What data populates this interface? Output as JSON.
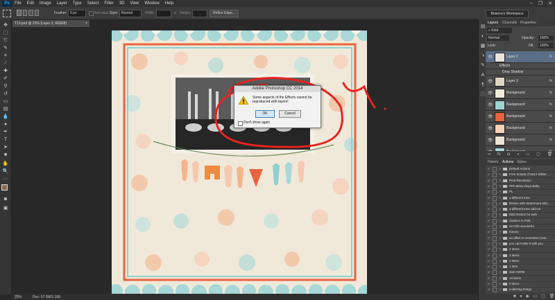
{
  "app": {
    "logo": "Ps"
  },
  "menu": [
    "File",
    "Edit",
    "Image",
    "Layer",
    "Type",
    "Select",
    "Filter",
    "3D",
    "View",
    "Window",
    "Help"
  ],
  "window_controls": [
    "–",
    "❐",
    "✕"
  ],
  "options_bar": {
    "feather_label": "Feather:",
    "feather_value": "0 px",
    "anti_alias_label": "Anti-alias",
    "style_label": "Style:",
    "style_value": "Normal",
    "width_label": "Width:",
    "height_label": "Height:",
    "refine_edge_label": "Refine Edge...",
    "workspace": "Brianna's Workspace"
  },
  "document_tab": "T10.psd @ 25% (Layer 2, RGB/8)",
  "status": {
    "zoom": "25%",
    "doc": "Doc: 37.3M/1.19G"
  },
  "dialog": {
    "title": "Adobe Photoshop CC 2014",
    "message": "Some aspects of the Effects cannot be reproduced with layers!",
    "ok_label": "OK",
    "cancel_label": "Cancel",
    "dont_show_label": "Don't show again"
  },
  "layers_panel": {
    "tabs": [
      "Layers",
      "Channels",
      "Properties"
    ],
    "kind_label": "Kind",
    "blend_mode": "Normal",
    "opacity_label": "Opacity:",
    "opacity_value": "100%",
    "lock_label": "Lock:",
    "fill_label": "Fill:",
    "fill_value": "100%",
    "layers": [
      {
        "name": "Layer 2",
        "fx": "fx",
        "color": "#e9e4d8"
      },
      {
        "name": "Effects",
        "fx": "",
        "color": ""
      },
      {
        "name": "Drop Shadow",
        "fx": "",
        "color": ""
      },
      {
        "name": "Layer 3",
        "fx": "fx",
        "color": "#ddd6c6"
      },
      {
        "name": "Background",
        "fx": "fx",
        "color": "#f0e9d9"
      },
      {
        "name": "Background",
        "fx": "fx",
        "color": "#9fd3d2"
      },
      {
        "name": "Background",
        "fx": "fx",
        "color": "#e8643f"
      },
      {
        "name": "Background",
        "fx": "fx",
        "color": "#f3d2b9"
      },
      {
        "name": "Background",
        "fx": "fx",
        "color": "#ece3d2"
      },
      {
        "name": "Background",
        "fx": "fx",
        "color": "#a8d8d8"
      }
    ]
  },
  "actions_panel": {
    "tabs": [
      "History",
      "Actions",
      "Styles"
    ],
    "actions": [
      "Default Actions",
      "Free Scripts (©2013 Glitter ...",
      "Print Resolution",
      "PPA Many Days Baby",
      "PL",
      "a different tone",
      "Resize with Watermark 600...",
      "a different tone add-on",
      "EBS Resize for web",
      "classics in PSE",
      "isn't life wonderful",
      "harvey",
      "an affair to remember (resi...",
      "you can't take it with you",
      "4 items",
      "3 items",
      "2 items",
      "1 item",
      "start HERE",
      "10 items",
      "9 items",
      "collecting things"
    ]
  },
  "colors": {
    "accent_red": "#e8231f",
    "frame_orange": "#e8643f",
    "frame_teal": "#8fcfd2"
  }
}
